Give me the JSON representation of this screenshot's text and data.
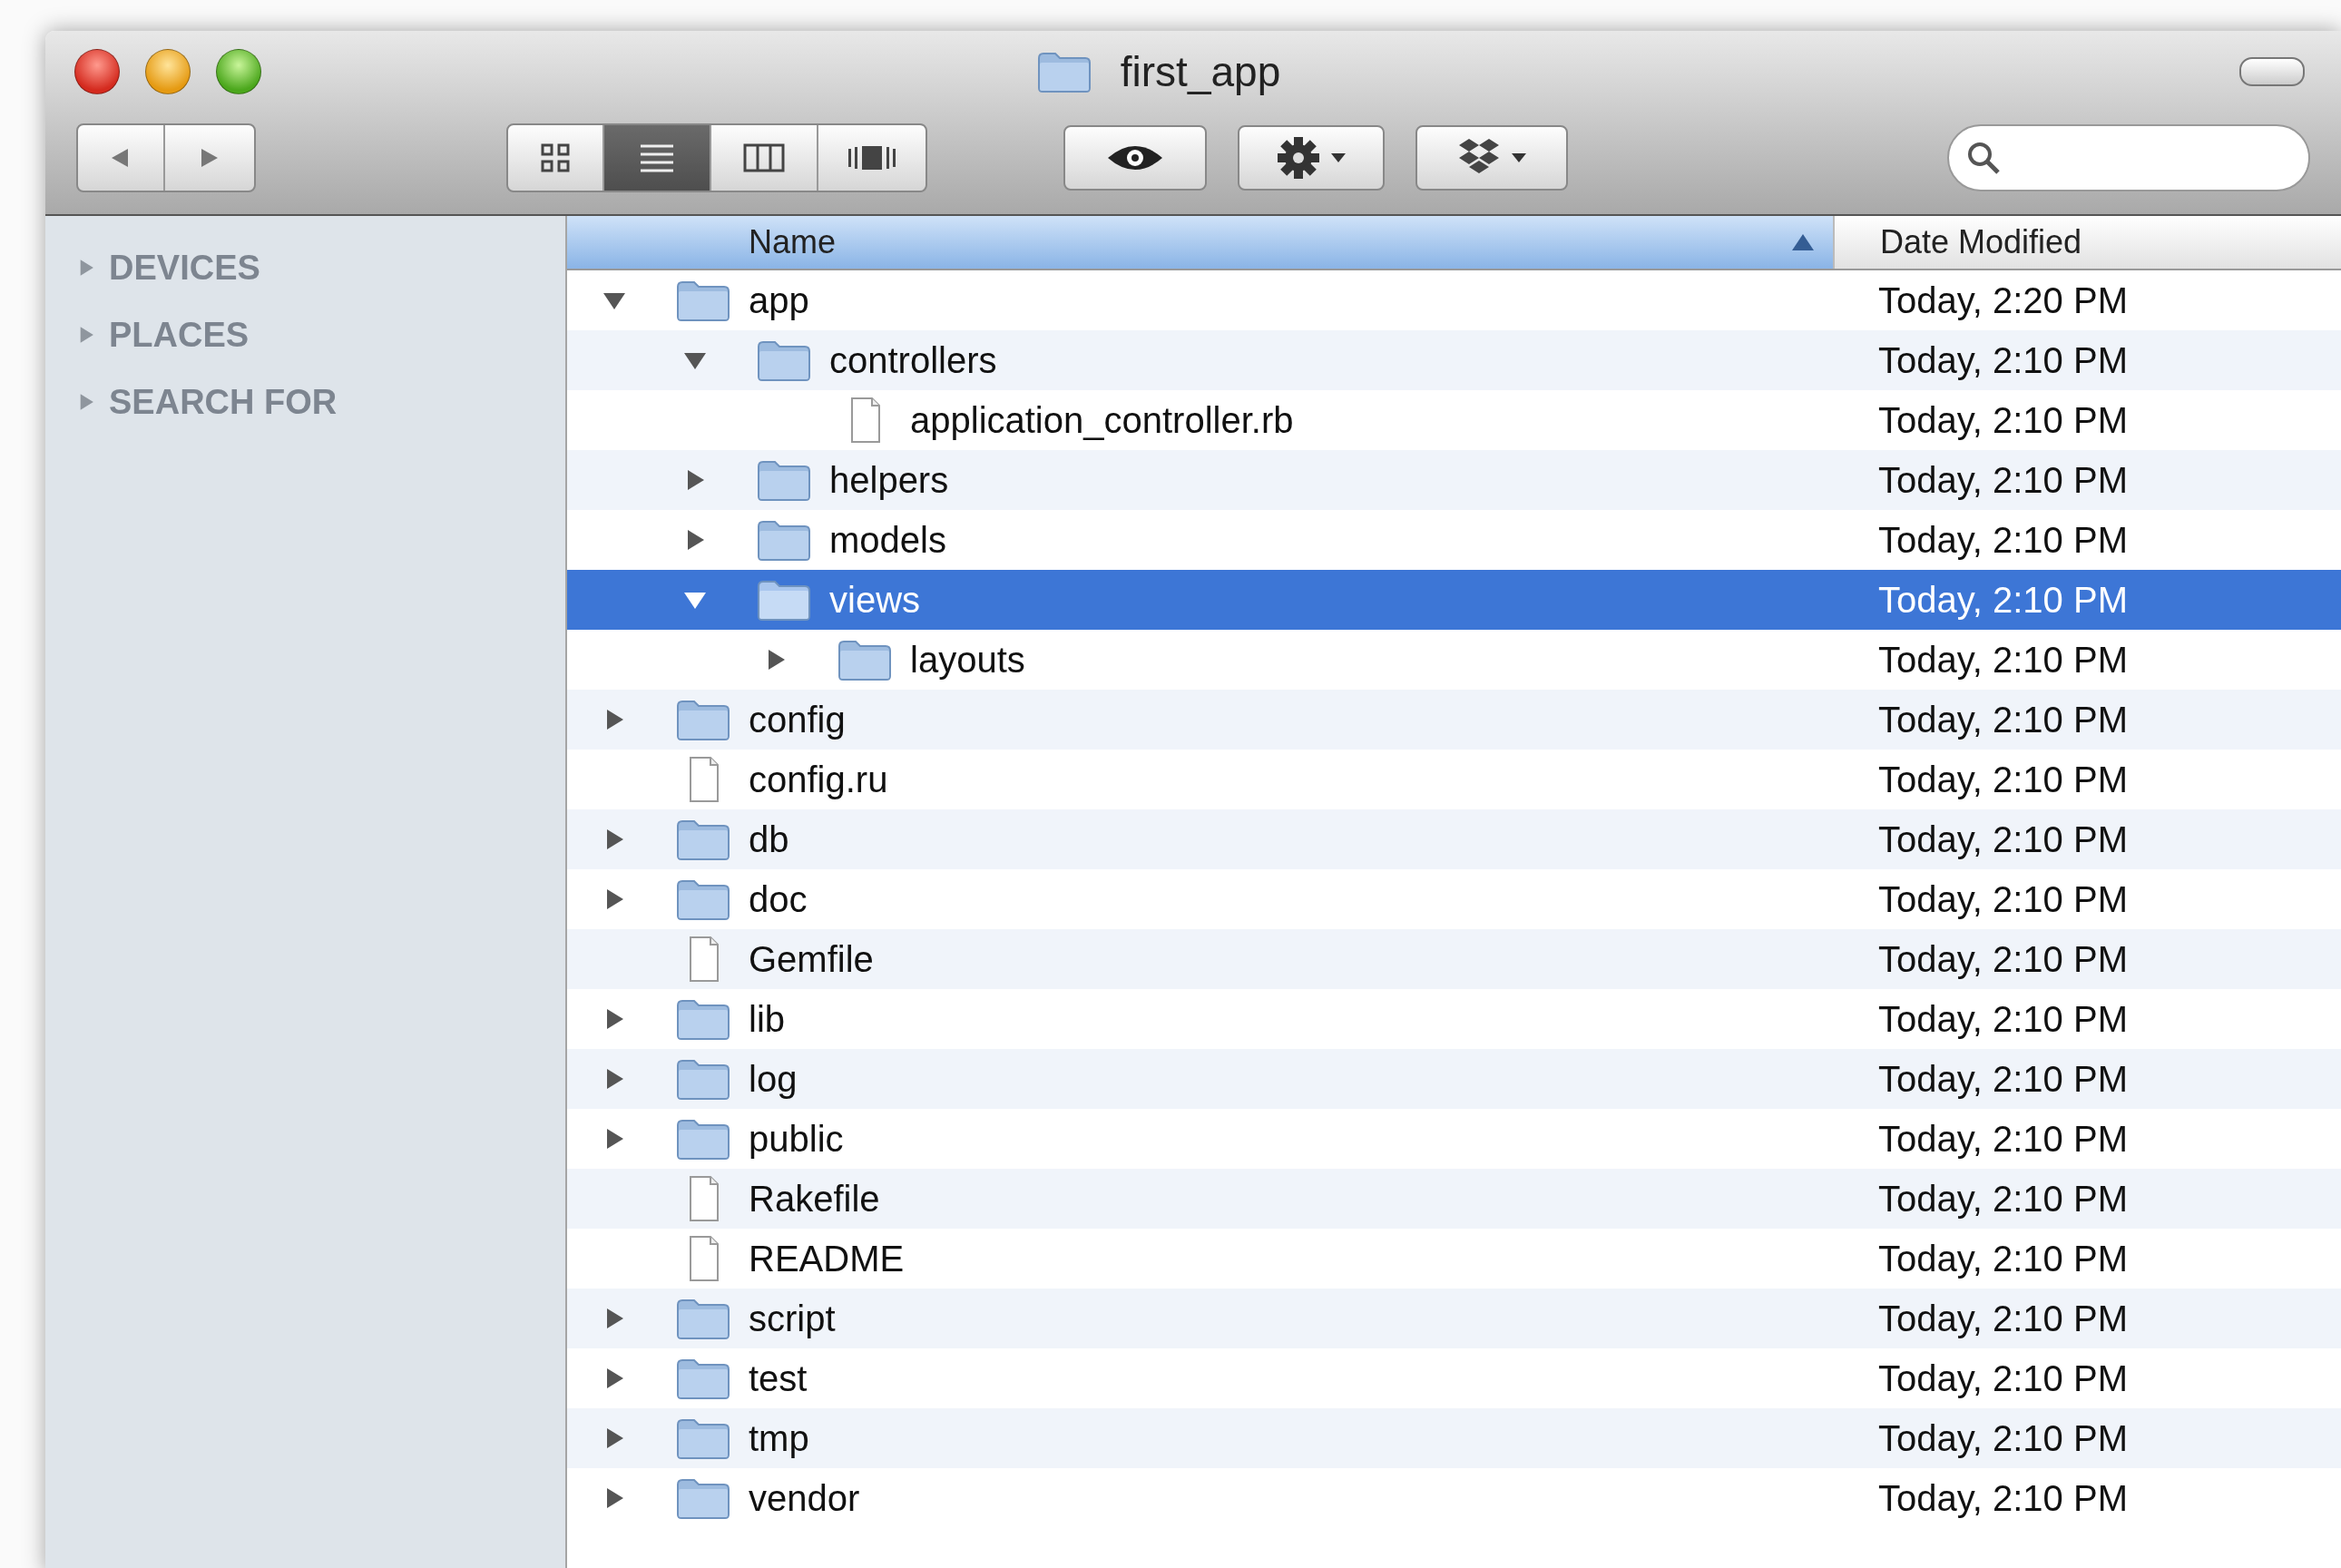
{
  "window": {
    "title": "first_app"
  },
  "toolbar": {
    "view_modes": [
      {
        "kind": "icons",
        "selected": false
      },
      {
        "kind": "list",
        "selected": true
      },
      {
        "kind": "columns",
        "selected": false
      },
      {
        "kind": "coverflow",
        "selected": false
      }
    ]
  },
  "sidebar": {
    "sections": [
      {
        "label": "DEVICES",
        "expanded": false
      },
      {
        "label": "PLACES",
        "expanded": false
      },
      {
        "label": "SEARCH FOR",
        "expanded": false
      }
    ]
  },
  "columns": [
    {
      "label": "Name",
      "sorted": true
    },
    {
      "label": "Date Modified",
      "sorted": false
    }
  ],
  "files": [
    {
      "name": "app",
      "kind": "folder",
      "expanded": true,
      "selected": false,
      "modified": "Today, 2:20 PM",
      "children": [
        {
          "name": "controllers",
          "kind": "folder",
          "expanded": true,
          "selected": false,
          "modified": "Today, 2:10 PM",
          "children": [
            {
              "name": "application_controller.rb",
              "kind": "file",
              "selected": false,
              "modified": "Today, 2:10 PM"
            }
          ]
        },
        {
          "name": "helpers",
          "kind": "folder",
          "expanded": false,
          "selected": false,
          "modified": "Today, 2:10 PM"
        },
        {
          "name": "models",
          "kind": "folder",
          "expanded": false,
          "selected": false,
          "modified": "Today, 2:10 PM"
        },
        {
          "name": "views",
          "kind": "folder",
          "expanded": true,
          "selected": true,
          "modified": "Today, 2:10 PM",
          "children": [
            {
              "name": "layouts",
              "kind": "folder",
              "expanded": false,
              "selected": false,
              "modified": "Today, 2:10 PM"
            }
          ]
        }
      ]
    },
    {
      "name": "config",
      "kind": "folder",
      "expanded": false,
      "selected": false,
      "modified": "Today, 2:10 PM"
    },
    {
      "name": "config.ru",
      "kind": "file",
      "selected": false,
      "modified": "Today, 2:10 PM"
    },
    {
      "name": "db",
      "kind": "folder",
      "expanded": false,
      "selected": false,
      "modified": "Today, 2:10 PM"
    },
    {
      "name": "doc",
      "kind": "folder",
      "expanded": false,
      "selected": false,
      "modified": "Today, 2:10 PM"
    },
    {
      "name": "Gemfile",
      "kind": "file",
      "selected": false,
      "modified": "Today, 2:10 PM"
    },
    {
      "name": "lib",
      "kind": "folder",
      "expanded": false,
      "selected": false,
      "modified": "Today, 2:10 PM"
    },
    {
      "name": "log",
      "kind": "folder",
      "expanded": false,
      "selected": false,
      "modified": "Today, 2:10 PM"
    },
    {
      "name": "public",
      "kind": "folder",
      "expanded": false,
      "selected": false,
      "modified": "Today, 2:10 PM"
    },
    {
      "name": "Rakefile",
      "kind": "file",
      "selected": false,
      "modified": "Today, 2:10 PM"
    },
    {
      "name": "README",
      "kind": "file",
      "selected": false,
      "modified": "Today, 2:10 PM"
    },
    {
      "name": "script",
      "kind": "folder",
      "expanded": false,
      "selected": false,
      "modified": "Today, 2:10 PM"
    },
    {
      "name": "test",
      "kind": "folder",
      "expanded": false,
      "selected": false,
      "modified": "Today, 2:10 PM"
    },
    {
      "name": "tmp",
      "kind": "folder",
      "expanded": false,
      "selected": false,
      "modified": "Today, 2:10 PM"
    },
    {
      "name": "vendor",
      "kind": "folder",
      "expanded": false,
      "selected": false,
      "modified": "Today, 2:10 PM"
    }
  ]
}
